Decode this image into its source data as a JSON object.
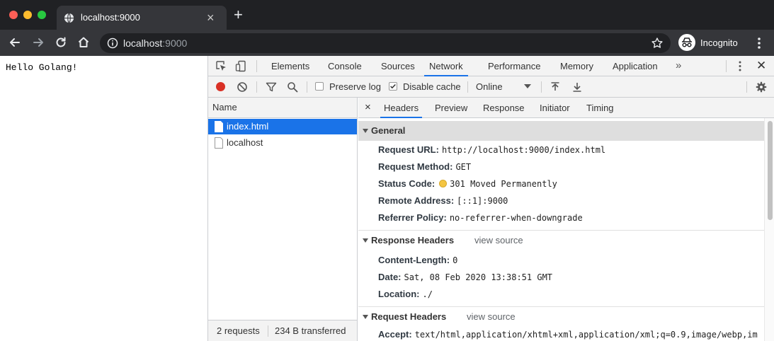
{
  "browser": {
    "tab_title": "localhost:9000",
    "url_host": "localhost",
    "url_port": ":9000",
    "profile_label": "Incognito"
  },
  "page": {
    "body_text": "Hello Golang!"
  },
  "devtools": {
    "tabs": [
      "Elements",
      "Console",
      "Sources",
      "Network",
      "Performance",
      "Memory",
      "Application"
    ],
    "active_tab": "Network",
    "more_tabs": "»"
  },
  "network_toolbar": {
    "preserve_log_label": "Preserve log",
    "preserve_log_checked": false,
    "disable_cache_label": "Disable cache",
    "disable_cache_checked": true,
    "throttling": "Online"
  },
  "requests": {
    "header": "Name",
    "rows": [
      {
        "name": "index.html",
        "selected": true
      },
      {
        "name": "localhost",
        "selected": false
      }
    ],
    "summary_count": "2 requests",
    "summary_transferred": "234 B transferred"
  },
  "detail": {
    "close_glyph": "×",
    "tabs": [
      "Headers",
      "Preview",
      "Response",
      "Initiator",
      "Timing"
    ],
    "active_tab": "Headers",
    "general": {
      "title": "General",
      "items": [
        {
          "key": "Request URL:",
          "value": "http://localhost:9000/index.html"
        },
        {
          "key": "Request Method:",
          "value": "GET"
        },
        {
          "key": "Status Code:",
          "value": "301 Moved Permanently"
        },
        {
          "key": "Remote Address:",
          "value": "[::1]:9000"
        },
        {
          "key": "Referrer Policy:",
          "value": "no-referrer-when-downgrade"
        }
      ]
    },
    "response_headers": {
      "title": "Response Headers",
      "view_source": "view source",
      "items": [
        {
          "key": "Content-Length:",
          "value": "0"
        },
        {
          "key": "Date:",
          "value": "Sat, 08 Feb 2020 13:38:51 GMT"
        },
        {
          "key": "Location:",
          "value": "./"
        }
      ]
    },
    "request_headers": {
      "title": "Request Headers",
      "view_source": "view source",
      "items": [
        {
          "key": "Accept:",
          "value": "text/html,application/xhtml+xml,application/xml;q=0.9,image/webp,im"
        }
      ]
    }
  },
  "colors": {
    "accent": "#1a73e8",
    "record": "#d93025",
    "status_dot": "#f4c542"
  }
}
